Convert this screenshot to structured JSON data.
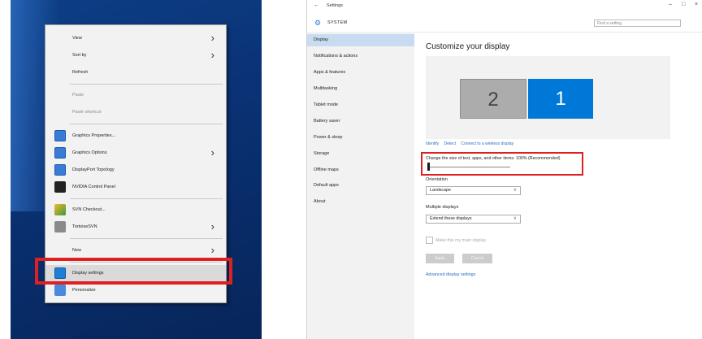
{
  "context_menu": {
    "items": [
      {
        "label": "View",
        "submenu": true
      },
      {
        "label": "Sort by",
        "submenu": true
      },
      {
        "label": "Refresh"
      },
      {
        "label": "Paste",
        "disabled": true
      },
      {
        "label": "Paste shortcut",
        "disabled": true
      },
      {
        "label": "Graphics Properties...",
        "icon": "intel-graphics-icon"
      },
      {
        "label": "Graphics Options",
        "icon": "intel-graphics-icon",
        "submenu": true
      },
      {
        "label": "DisplayPort Topology",
        "icon": "intel-graphics-icon"
      },
      {
        "label": "NVIDIA Control Panel",
        "icon": "nvidia-icon"
      },
      {
        "label": "SVN Checkout...",
        "icon": "svn-checkout-icon"
      },
      {
        "label": "TortoiseSVN",
        "icon": "tortoise-icon",
        "submenu": true
      },
      {
        "label": "New",
        "submenu": true
      },
      {
        "label": "Display settings",
        "icon": "display-settings-icon",
        "highlighted": true
      },
      {
        "label": "Personalize",
        "icon": "personalize-icon"
      }
    ]
  },
  "settings": {
    "window_title": "Settings",
    "section_title": "SYSTEM",
    "search_placeholder": "Find a setting",
    "sidebar": [
      {
        "label": "Display",
        "selected": true
      },
      {
        "label": "Notifications & actions"
      },
      {
        "label": "Apps & features"
      },
      {
        "label": "Multitasking"
      },
      {
        "label": "Tablet mode"
      },
      {
        "label": "Battery saver"
      },
      {
        "label": "Power & sleep"
      },
      {
        "label": "Storage"
      },
      {
        "label": "Offline maps"
      },
      {
        "label": "Default apps"
      },
      {
        "label": "About"
      }
    ],
    "heading": "Customize your display",
    "monitor_1": "1",
    "monitor_2": "2",
    "link_identify": "Identify",
    "link_detect": "Detect",
    "link_wireless": "Connect to a wireless display",
    "scale_label": "Change the size of text, apps, and other items: 100% (Recommended)",
    "orientation_label": "Orientation",
    "orientation_value": "Landscape",
    "multiple_displays_label": "Multiple displays",
    "multiple_displays_value": "Extend these displays",
    "main_display_label": "Make this my main display",
    "apply_label": "Apply",
    "cancel_label": "Cancel",
    "advanced_link": "Advanced display settings",
    "accent_color": "#0078d7"
  }
}
